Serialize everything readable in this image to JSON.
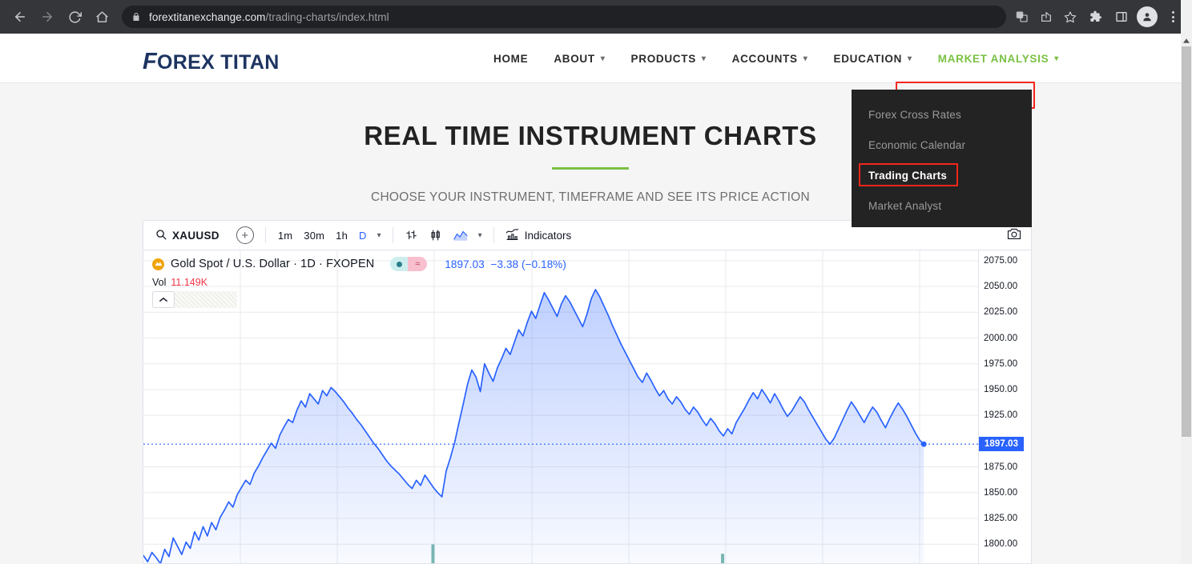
{
  "browser": {
    "url_domain": "forextitanexchange.com",
    "url_path": "/trading-charts/index.html",
    "icons": [
      "back-icon",
      "forward-icon",
      "reload-icon",
      "home-icon",
      "lock-icon",
      "translate-icon",
      "share-icon",
      "bookmark-star-icon",
      "extensions-icon",
      "side-panel-icon",
      "profile-avatar-icon",
      "chrome-menu-icon"
    ]
  },
  "site": {
    "logo_first": "F",
    "logo_rest": "OREX TITAN",
    "nav": [
      {
        "label": "HOME",
        "caret": false
      },
      {
        "label": "ABOUT",
        "caret": true
      },
      {
        "label": "PRODUCTS",
        "caret": true
      },
      {
        "label": "ACCOUNTS",
        "caret": true
      },
      {
        "label": "EDUCATION",
        "caret": true
      },
      {
        "label": "MARKET ANALYSIS",
        "caret": true
      }
    ],
    "active_nav": "MARKET ANALYSIS",
    "accent_green": "#7ac143",
    "highlight_red": "#f2271c",
    "dropdown": {
      "items": [
        "Forex Cross Rates",
        "Economic Calendar",
        "Trading Charts",
        "Market Analyst"
      ],
      "selected": "Trading Charts"
    }
  },
  "hero": {
    "title": "REAL TIME INSTRUMENT CHARTS",
    "subtitle": "CHOOSE YOUR INSTRUMENT, TIMEFRAME AND SEE ITS PRICE ACTION"
  },
  "chart_widget": {
    "toolbar": {
      "symbol": "XAUUSD",
      "search_icon": "search-icon",
      "add_symbol": "+",
      "timeframes": [
        "1m",
        "30m",
        "1h",
        "D"
      ],
      "active_timeframe": "D",
      "chart_types": [
        "bar-chart-icon",
        "candlestick-icon",
        "area-chart-icon"
      ],
      "active_chart_type": "area-chart-icon",
      "indicators_label": "Indicators",
      "camera_icon": "camera-icon"
    },
    "legend": {
      "symbol_icon": "gold-bar-icon",
      "title": "Gold Spot / U.S. Dollar · 1D · FXOPEN",
      "last_price": "1897.03",
      "change": "−3.38",
      "change_pct": "(−0.18%)",
      "volume_label": "Vol",
      "volume_value": "11.149K",
      "collapse_icon": "chevron-up-icon"
    }
  },
  "chart_data": {
    "type": "area",
    "title": "Gold Spot / U.S. Dollar · 1D · FXOPEN",
    "symbol": "XAUUSD",
    "interval": "1D",
    "exchange": "FXOPEN",
    "series_name": "XAUUSD close",
    "line_color": "#2962ff",
    "fill_color": "#2962ff",
    "last_price": 1897.03,
    "change": -3.38,
    "change_percent": -0.18,
    "ylabel": "",
    "xlabel": "",
    "ylim": [
      1780,
      2085
    ],
    "grid": true,
    "y_ticks": [
      2075.0,
      2050.0,
      2025.0,
      2000.0,
      1975.0,
      1950.0,
      1925.0,
      1875.0,
      1850.0,
      1825.0,
      1800.0
    ],
    "y_tick_labels": [
      "2075.00",
      "2050.00",
      "2025.00",
      "2000.00",
      "1975.00",
      "1950.00",
      "1925.00",
      "1875.00",
      "1850.00",
      "1825.00",
      "1800.00"
    ],
    "price_line": {
      "value": 1897.03,
      "label": "1897.03",
      "style": "dotted",
      "color": "#2962ff"
    },
    "values": [
      1789,
      1783,
      1792,
      1787,
      1781,
      1795,
      1788,
      1806,
      1798,
      1790,
      1802,
      1796,
      1812,
      1804,
      1817,
      1808,
      1821,
      1814,
      1826,
      1833,
      1841,
      1836,
      1848,
      1855,
      1862,
      1858,
      1869,
      1876,
      1884,
      1891,
      1898,
      1893,
      1906,
      1914,
      1921,
      1918,
      1930,
      1939,
      1933,
      1946,
      1941,
      1936,
      1949,
      1944,
      1952,
      1948,
      1943,
      1938,
      1932,
      1927,
      1921,
      1916,
      1910,
      1904,
      1898,
      1893,
      1887,
      1881,
      1876,
      1872,
      1868,
      1863,
      1858,
      1854,
      1862,
      1857,
      1867,
      1861,
      1855,
      1850,
      1846,
      1871,
      1884,
      1899,
      1918,
      1936,
      1955,
      1969,
      1962,
      1948,
      1975,
      1966,
      1958,
      1971,
      1980,
      1990,
      1984,
      1996,
      2008,
      2002,
      2015,
      2026,
      2019,
      2032,
      2044,
      2037,
      2029,
      2021,
      2033,
      2041,
      2035,
      2027,
      2019,
      2011,
      2023,
      2038,
      2047,
      2040,
      2031,
      2022,
      2012,
      2003,
      1994,
      1986,
      1978,
      1970,
      1962,
      1957,
      1966,
      1959,
      1951,
      1944,
      1949,
      1941,
      1936,
      1943,
      1938,
      1931,
      1926,
      1933,
      1928,
      1921,
      1915,
      1922,
      1917,
      1910,
      1905,
      1912,
      1907,
      1918,
      1925,
      1932,
      1940,
      1947,
      1941,
      1950,
      1944,
      1937,
      1946,
      1939,
      1931,
      1924,
      1929,
      1936,
      1943,
      1938,
      1930,
      1923,
      1916,
      1909,
      1902,
      1897,
      1903,
      1912,
      1921,
      1930,
      1938,
      1932,
      1925,
      1918,
      1926,
      1933,
      1928,
      1920,
      1913,
      1922,
      1930,
      1937,
      1931,
      1924,
      1916,
      1908,
      1901,
      1897.03
    ],
    "volume_bars": [
      {
        "x_ratio": 0.345,
        "height_ratio": 0.065,
        "color": "#7bb8b0"
      },
      {
        "x_ratio": 0.692,
        "height_ratio": 0.035,
        "color": "#7bb8b0"
      }
    ]
  }
}
